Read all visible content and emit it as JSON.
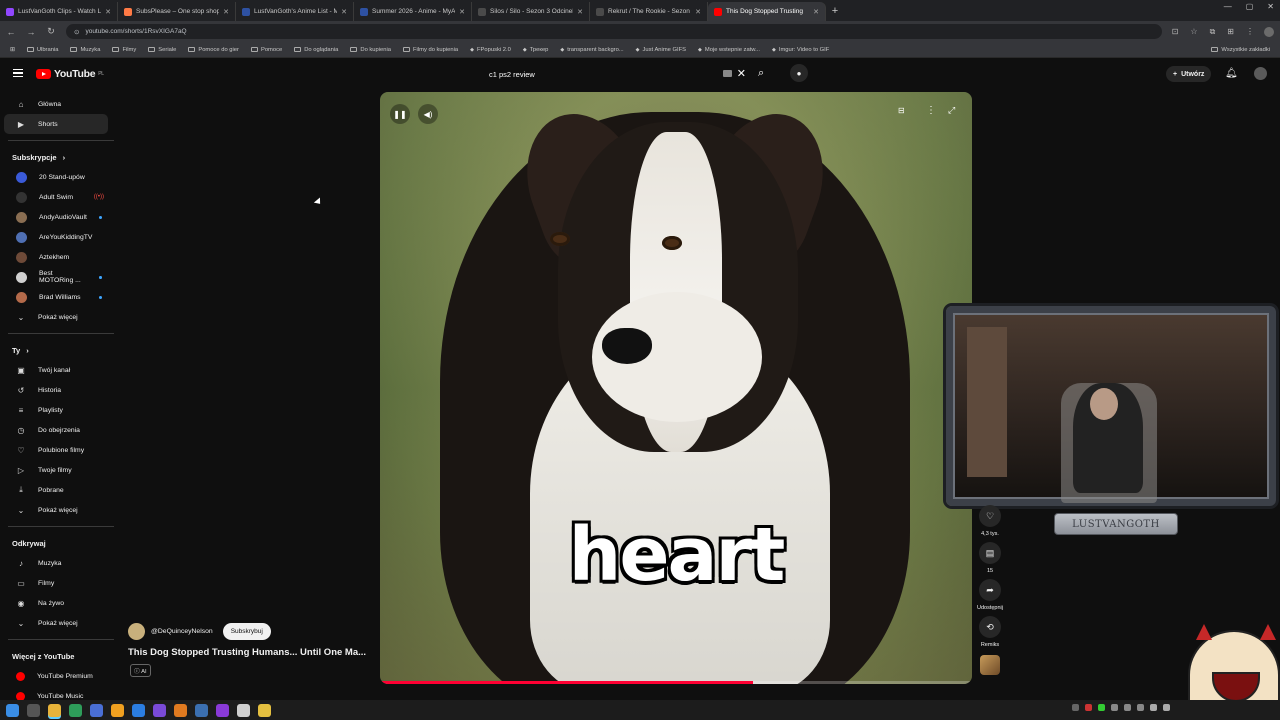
{
  "browser": {
    "tabs": [
      {
        "label": "LustVanGoth Clips - Watch Liv",
        "color": "#9147ff",
        "active": false
      },
      {
        "label": "SubsPlease – One stop shop fo",
        "color": "#ff7a45",
        "active": false
      },
      {
        "label": "LustVanGoth's Anime List - My",
        "color": "#2e51a2",
        "active": false
      },
      {
        "label": "Summer 2026 - Anime - MyAni",
        "color": "#2e51a2",
        "active": false
      },
      {
        "label": "Silos / Silo - Sezon 3 Odcinek 2",
        "color": "#4a4a4a",
        "active": false
      },
      {
        "label": "Rekrut / The Rookie - Sezon 2",
        "color": "#4a4a4a",
        "active": false
      },
      {
        "label": "This Dog Stopped Trusting",
        "color": "#ff0000",
        "active": true
      }
    ],
    "url": "youtube.com/shorts/1RsvXIGA7aQ",
    "bookmarks": [
      {
        "label": "Ulbrania",
        "type": "folder"
      },
      {
        "label": "Muzyka",
        "type": "folder"
      },
      {
        "label": "Filmy",
        "type": "folder"
      },
      {
        "label": "Seriale",
        "type": "folder"
      },
      {
        "label": "Pomoce do gier",
        "type": "folder"
      },
      {
        "label": "Pomoce",
        "type": "folder"
      },
      {
        "label": "Do oglądania",
        "type": "folder"
      },
      {
        "label": "Do kupienia",
        "type": "folder"
      },
      {
        "label": "Filmy do kupienia",
        "type": "folder"
      },
      {
        "label": "FPopuski 2.0",
        "type": "link"
      },
      {
        "label": "Трекер",
        "type": "link"
      },
      {
        "label": "transparent backgro...",
        "type": "link"
      },
      {
        "label": "Just Anime GIFS",
        "type": "link"
      },
      {
        "label": "Moje wstepnie zatw...",
        "type": "link"
      },
      {
        "label": "Imgur: Video to GIF",
        "type": "link"
      }
    ],
    "bookmarks_right": "Wszystkie zakładki"
  },
  "header": {
    "logo_text": "YouTube",
    "region": "PL",
    "search_value": "c1 ps2 review",
    "create_label": "Utwórz"
  },
  "sidebar": {
    "main": [
      {
        "label": "Główna",
        "icon": "home-icon",
        "glyph": "⌂",
        "active": false
      },
      {
        "label": "Shorts",
        "icon": "shorts-icon",
        "glyph": "▶",
        "active": true
      }
    ],
    "subs_heading": "Subskrypcje",
    "subscriptions": [
      {
        "label": "20 Stand-upów",
        "color": "#3a5ad8",
        "badge": ""
      },
      {
        "label": "Adult Swim",
        "color": "#333333",
        "badge": "live"
      },
      {
        "label": "AndyAudioVault",
        "color": "#8a6e52",
        "badge": "dot"
      },
      {
        "label": "AreYouKiddingTV",
        "color": "#4f6fb3",
        "badge": "dot"
      },
      {
        "label": "Aztekhem",
        "color": "#6e4a38",
        "badge": ""
      },
      {
        "label": "Best MOTORing ...",
        "color": "#d0d0d0",
        "badge": "dot"
      },
      {
        "label": "Brad Williams",
        "color": "#b46a4a",
        "badge": "dot"
      }
    ],
    "show_more": "Pokaż więcej",
    "you_heading": "Ty",
    "you_items": [
      {
        "label": "Twój kanał",
        "icon": "channel-icon",
        "glyph": "▣"
      },
      {
        "label": "Historia",
        "icon": "history-icon",
        "glyph": "↺"
      },
      {
        "label": "Playlisty",
        "icon": "playlist-icon",
        "glyph": "≡"
      },
      {
        "label": "Do obejrzenia",
        "icon": "watch-later-icon",
        "glyph": "◷"
      },
      {
        "label": "Polubione filmy",
        "icon": "like-icon",
        "glyph": "♡"
      },
      {
        "label": "Twoje filmy",
        "icon": "your-videos-icon",
        "glyph": "▷"
      },
      {
        "label": "Pobrane",
        "icon": "download-icon",
        "glyph": "⤓"
      }
    ],
    "explore_heading": "Odkrywaj",
    "explore_items": [
      {
        "label": "Muzyka",
        "icon": "music-icon",
        "glyph": "♪"
      },
      {
        "label": "Filmy",
        "icon": "film-icon",
        "glyph": "▭"
      },
      {
        "label": "Na żywo",
        "icon": "live-icon",
        "glyph": "◉"
      }
    ],
    "more_heading": "Więcej z YouTube",
    "more_items": [
      {
        "label": "YouTube Premium",
        "icon": "youtube-premium-icon"
      },
      {
        "label": "YouTube Music",
        "icon": "youtube-music-icon"
      }
    ]
  },
  "video": {
    "caption": "heart",
    "progress": 0.63,
    "channel": "@DeQuinceyNelson",
    "subscribe_label": "Subskrybuj",
    "title": "This Dog Stopped Trusting Humans... Until One Ma...",
    "ai_badge": "AI"
  },
  "actions": {
    "likes": "4,3 tys.",
    "comments": "15",
    "share": "Udostępnij",
    "remix": "Remiks"
  },
  "overlay": {
    "nameplate": "LUSTVANGOTH"
  }
}
